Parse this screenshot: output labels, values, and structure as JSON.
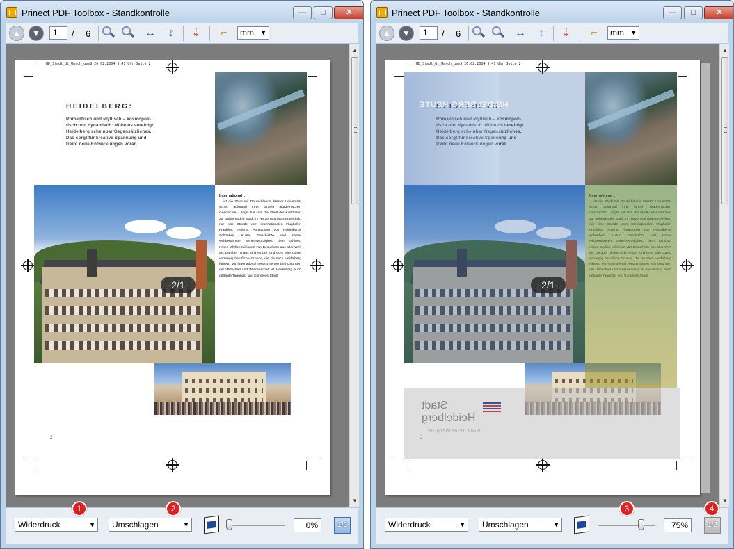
{
  "windows": [
    {
      "title": "Prinect PDF Toolbox - Standkontrolle",
      "toolbar": {
        "page_current": "1",
        "page_sep": "/",
        "page_total": "6",
        "unit": "mm"
      },
      "page_label": "-2/1-",
      "bottom": {
        "print_mode": "Widerdruck",
        "flip_mode": "Umschlagen",
        "opacity": "0%",
        "half_button": "1/2",
        "badge_a": "1",
        "badge_b": "2",
        "slider_level": 0.0
      }
    },
    {
      "title": "Prinect PDF Toolbox - Standkontrolle",
      "toolbar": {
        "page_current": "1",
        "page_sep": "/",
        "page_total": "6",
        "unit": "mm"
      },
      "page_label": "-2/1-",
      "bottom": {
        "print_mode": "Widerdruck",
        "flip_mode": "Umschlagen",
        "opacity": "75%",
        "half_button": "1/2",
        "badge_a": "3",
        "badge_b": "4",
        "slider_level": 0.75
      }
    }
  ],
  "document": {
    "header_line": "HD_Stadt_dt_Umsch_gemS   26.02.2004   9:41 Uhr   Seite 2",
    "headline": "HEIDELBERG:",
    "intro": "Romantisch und idyllisch – kosmopoli-\ntisch und dynamisch: Mühelos vereinigt\nHeidelberg scheinbar Gegensätzliches.\nDas sorgt für kreative Spannung und\ntreibt neue Entwicklungen voran.",
    "column_head": "International ...",
    "column_text": "... ist die Stadt mit Deutschlands ältester Universität schon aufgrund ihrer langen akademischen Geschichte. Längst hat sich die Stadt der Kurfürsten zur pulsierenden Stadt im Herzen Europas entwickelt, nur eine Stunde vom internationalen Flughafen Frankfurt entfernt. Angezogen von Heidelbergs Schönheit, Kultur, Geschichte und seiner weltberühmten Sehenswürdigkeit, dem Schloss, reisen jährlich Millionen von Besuchern aus aller Welt an. Darüber hinaus sind es bei rund 60% aller Gäste vorrangig berufliche Gründe, die sie nach Heidelberg führen. Mit international renommierten Einrichtungen der Wirtschaft und Wissenschaft ist Heidelberg auch gefragte Tagungs- und Kongress-Stadt.",
    "page_number": "2",
    "back_headline": "HEIDELBERG HEUTE",
    "back_logo_line1": "Stadt",
    "back_logo_line2": "Heidelberg",
    "back_url": "www.heidelberg.de"
  },
  "colors": {
    "accent": "#3a6fb2",
    "badge": "#e02020",
    "viewport": "#7c7c7c"
  }
}
